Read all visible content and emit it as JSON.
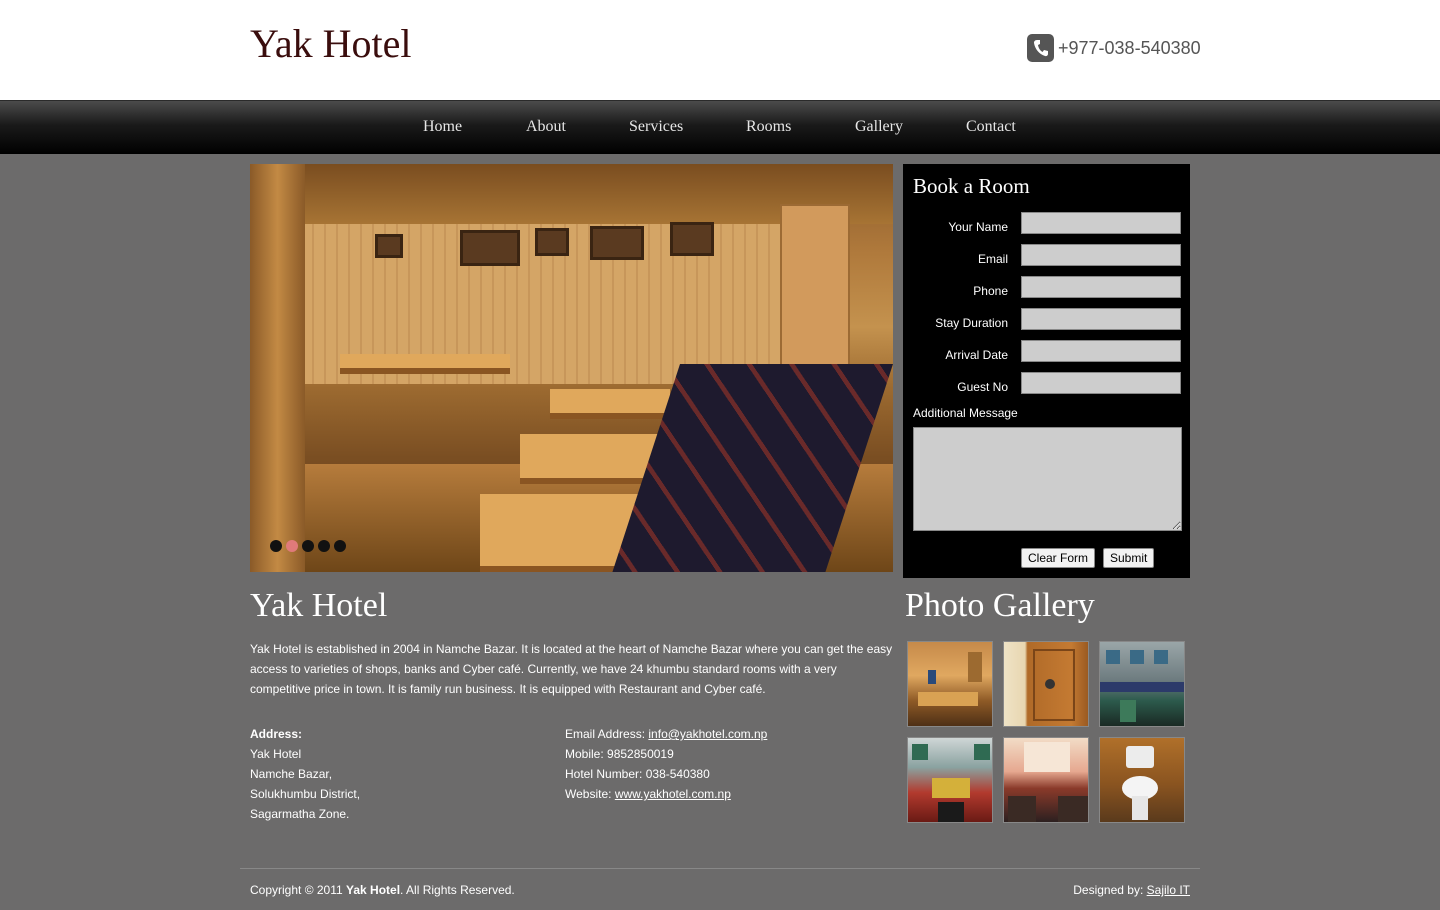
{
  "header": {
    "logo": "Yak Hotel",
    "phone": "+977-038-540380",
    "phone_icon": "phone-icon"
  },
  "nav": {
    "items": [
      {
        "label": "Home"
      },
      {
        "label": "About"
      },
      {
        "label": "Services"
      },
      {
        "label": "Rooms"
      },
      {
        "label": "Gallery"
      },
      {
        "label": "Contact"
      }
    ]
  },
  "slider": {
    "dots_count": 5,
    "active_index": 1,
    "active_color": "#e07a7a"
  },
  "booking": {
    "title": "Book a Room",
    "fields": [
      {
        "label": "Your Name",
        "value": ""
      },
      {
        "label": "Email",
        "value": ""
      },
      {
        "label": "Phone",
        "value": ""
      },
      {
        "label": "Stay Duration",
        "value": ""
      },
      {
        "label": "Arrival Date",
        "value": ""
      },
      {
        "label": "Guest No",
        "value": ""
      }
    ],
    "message_label": "Additional Message",
    "clear_label": "Clear Form",
    "submit_label": "Submit"
  },
  "about": {
    "title": "Yak Hotel",
    "text": "Yak Hotel is established in 2004 in Namche Bazar. It is located at the heart of Namche Bazar where you can get the easy access to varieties of shops, banks and Cyber café. Currently, we have 24 khumbu standard rooms with a very competitive price in town. It is family run business. It is equipped with Restaurant and Cyber café.",
    "address_heading": "Address:",
    "address_lines": [
      "Yak Hotel",
      "Namche Bazar,",
      "Solukhumbu District,",
      "Sagarmatha Zone."
    ],
    "email_label": "Email Address:",
    "email": "info@yakhotel.com.np",
    "mobile_label": "Mobile:",
    "mobile": "9852850019",
    "hotel_number_label": "Hotel Number:",
    "hotel_number": "038-540380",
    "website_label": "Website:",
    "website": "www.yakhotel.com.np"
  },
  "gallery": {
    "title": "Photo Gallery",
    "thumbs": [
      {
        "name": "restaurant"
      },
      {
        "name": "door"
      },
      {
        "name": "building"
      },
      {
        "name": "facade"
      },
      {
        "name": "bedroom"
      },
      {
        "name": "bathroom"
      }
    ]
  },
  "footer": {
    "copyright_prefix": "Copyright © 2011",
    "copyright_brand": "Yak Hotel",
    "copyright_suffix": ". All Rights Reserved.",
    "designed_label": "Designed by:",
    "designer": "Sajilo IT"
  }
}
